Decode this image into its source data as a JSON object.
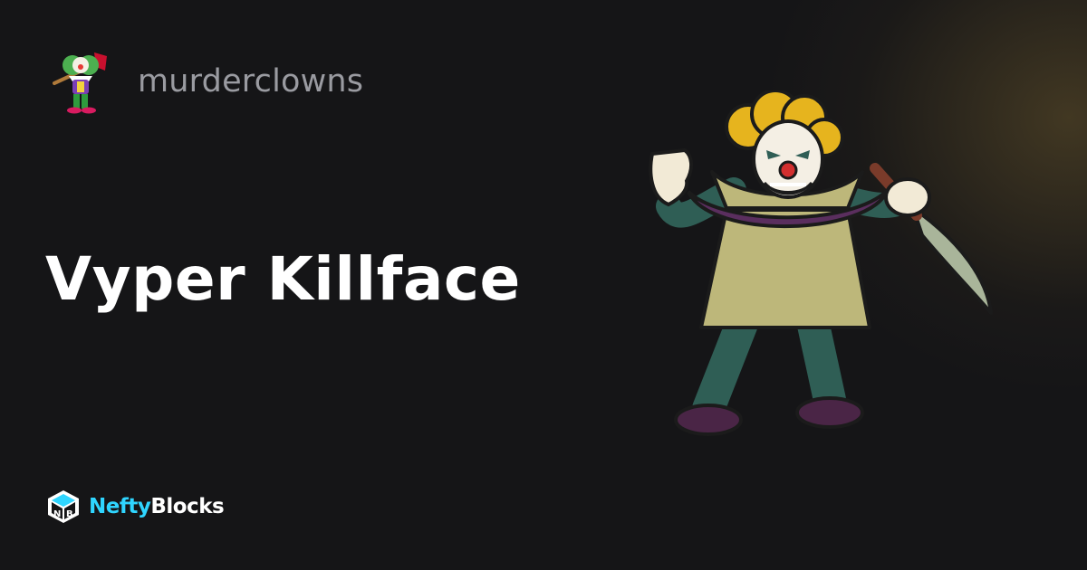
{
  "collection": {
    "name": "murderclowns",
    "logo_icon": "clown-with-axe-icon"
  },
  "asset": {
    "name": "Vyper Killface",
    "image_icon": "clown-with-sickle-illustration"
  },
  "brand": {
    "name_part1": "Nefty",
    "name_part2": "Blocks",
    "logo_icon": "neftyblocks-cube-icon",
    "accent_color": "#2fd5ff"
  },
  "colors": {
    "background": "#151517",
    "title": "#ffffff",
    "collection_name": "#9a9ba1"
  }
}
